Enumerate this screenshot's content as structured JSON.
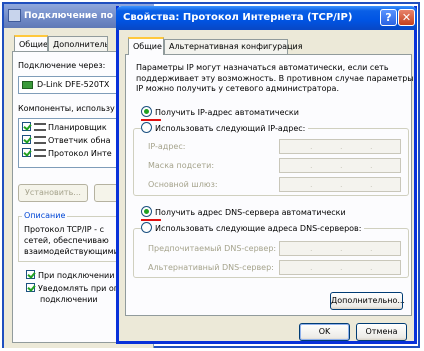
{
  "back_window": {
    "title": "Подключение по л",
    "tabs": [
      "Общие",
      "Дополнитель"
    ],
    "connect_using_label": "Подключение через:",
    "adapter_name": "D-Link DFE-520TX",
    "components_label": "Компоненты, использу",
    "components": [
      {
        "label": "Планировщик",
        "checked": true
      },
      {
        "label": "Ответчик обна",
        "checked": true
      },
      {
        "label": "Протокол Инте",
        "checked": true
      }
    ],
    "install_button": "Установить...",
    "description_legend": "Описание",
    "description_lines": [
      "Протокол TCP/IP - с",
      "сетей, обеспечиваю",
      "взаимодействующими"
    ],
    "show_icon_label": "При подключении вы",
    "notify_label_lines": [
      "Уведомлять при огр",
      "подключении"
    ]
  },
  "dialog": {
    "title": "Свойства: Протокол Интернета (TCP/IP)",
    "help_glyph": "?",
    "close_glyph": "✕",
    "tabs": [
      "Общие",
      "Альтернативная конфигурация"
    ],
    "intro_lines": [
      "Параметры IP могут назначаться автоматически, если сеть",
      "поддерживает эту возможность. В противном случае параметры",
      "IP можно получить у сетевого администратора."
    ],
    "ip_auto": "Получить IP-адрес автоматически",
    "ip_manual": "Использовать следующий IP-адрес:",
    "ip_fields": [
      "IP-адрес:",
      "Маска подсети:",
      "Основной шлюз:"
    ],
    "dns_auto": "Получить адрес DNS-сервера автоматически",
    "dns_manual": "Использовать следующие адреса DNS-серверов:",
    "dns_fields": [
      "Предпочитаемый DNS-сервер:",
      "Альтернативный DNS-сервер:"
    ],
    "ip_dot": ".",
    "advanced_button": "Дополнительно...",
    "ok_button": "OK",
    "cancel_button": "Отмена",
    "highlight_color": "#e01010"
  }
}
